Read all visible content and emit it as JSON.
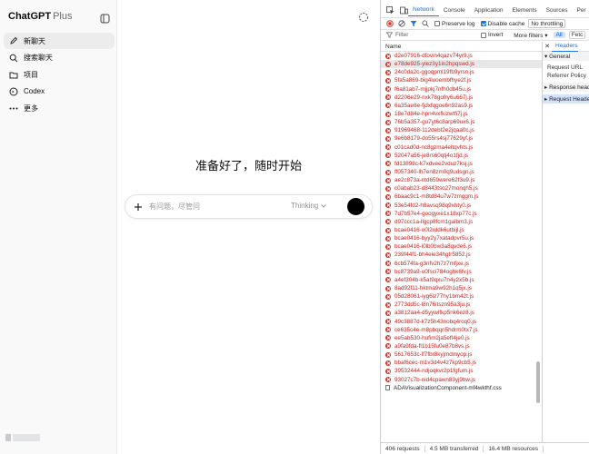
{
  "sidebar": {
    "brand_name": "ChatGPT",
    "brand_plan": "Plus",
    "items": [
      {
        "label": "新聊天",
        "icon": "compose-icon"
      },
      {
        "label": "搜索聊天",
        "icon": "search-icon"
      },
      {
        "label": "项目",
        "icon": "folder-icon"
      },
      {
        "label": "Codex",
        "icon": "codex-icon"
      },
      {
        "label": "更多",
        "icon": "more-icon"
      }
    ]
  },
  "main": {
    "headline": "准备好了，随时开始",
    "composer": {
      "placeholder": "有问题，尽管问",
      "model": "Thinking"
    }
  },
  "devtools": {
    "tabs": [
      "Network",
      "Console",
      "Application",
      "Elements",
      "Sources",
      "Per"
    ],
    "toolbar": {
      "preserve_log": "Preserve log",
      "disable_cache": "Disable cache",
      "throttling": "No throttling"
    },
    "filterbar": {
      "filter_placeholder": "Filter",
      "invert": "Invert",
      "more_filters": "More filters",
      "all": "All",
      "fetch": "Fetc"
    },
    "list_header": "Name",
    "requests": [
      "d2e07916-dfovin4qazv74yr9.js",
      "e78de925-ylez3y1in2hpqswd.js",
      "24c0da2c-ggoqpml19fb9yrsn.js",
      "5fa5a869-big4luoembfhye2f.js",
      "f6a81ab7-mjjpkj7nfh0db45u.js",
      "d2206e29-nxk78gofry6u667j.js",
      "6a35ae8e-fjdxfqgoe6n92as9.js",
      "18e7d84e-hpn4vxfkizwtfi7j.js",
      "76b5a357-gu7yt6c8arp69ux6.js",
      "91969468-112debt2e2jqaa0c.js",
      "9e6b8179-do55rs4sj77629yf.js",
      "c01cad0d-nc8gzma4eltqvhts.js",
      "52047a56-je8rs60qtj4o1fjd.js",
      "fd13898c-k7xdvee2vduz7ksj.js",
      "ff057340-lh7en8zm0q9udsgn.js",
      "ae2c873a-ntd659were62f3u9.js",
      "c0abab23-d8443tso27monqh5.js",
      "6baac9c1-m8td84u7w7zmggm.js",
      "53e54fd2-h8avsq98q9xhty0.js",
      "7d7b57e4-googyxe1x18xp77c.js",
      "d97ccc1a-llgcp8fcm1galbm3.js",
      "bcae0416-o0l2rddk6utbijl.js",
      "bcae0416-byy2y7xatadpvr5u.js",
      "bcae0416-i0lb0bw3a8qvde6.js",
      "239f44f1-bh4eie34hgtr5852.js",
      "6cb574fa-g3nfv2h7z7mfjxe.js",
      "bc8739a9-o0fsci784oghk6fv.js",
      "a4ef304b-k5at9qxu7n4y2x5b.js",
      "8ad92f11-hktma9w92h1q5jx.js",
      "05d28061-iyg6iz77hy1bm42t.js",
      "2773dd5c-l8n76itszn95a3ju.js",
      "a3812aa4-d5yywlfkp5nk6ez8.js",
      "49c3887d-k7z5h43nobq4roq0.js",
      "ce635c4e-m8pbqqn5hdrm0tx7.js",
      "ee5ab530-hufim2ja5eft4je0.js",
      "a9fa9fda-fl1b15fu0e87b8vs.js",
      "5617653c-lf7fbr8kyjmdmyop.js",
      "bbaf6cec-m1v3d4v4z7kp9cb5.js",
      "39532444-ndjoqkvr2p1fgfum.js",
      "93027c7b-nid4cpawn83yj9bw.js"
    ],
    "selected_index": 1,
    "last_request": "ADAVisualizationComponent-mf4wkthf.css",
    "details": {
      "close": "✕",
      "tab": "Headers",
      "general": "▾ General",
      "request_url": "Request URL",
      "referrer_policy": "Referrer Policy",
      "response_headers": "▸ Response heade",
      "request_headers": "▸ Request Header"
    },
    "status": {
      "requests": "406 requests",
      "transferred": "4.5 MB transferred",
      "resources": "16.4 MB resources"
    }
  }
}
